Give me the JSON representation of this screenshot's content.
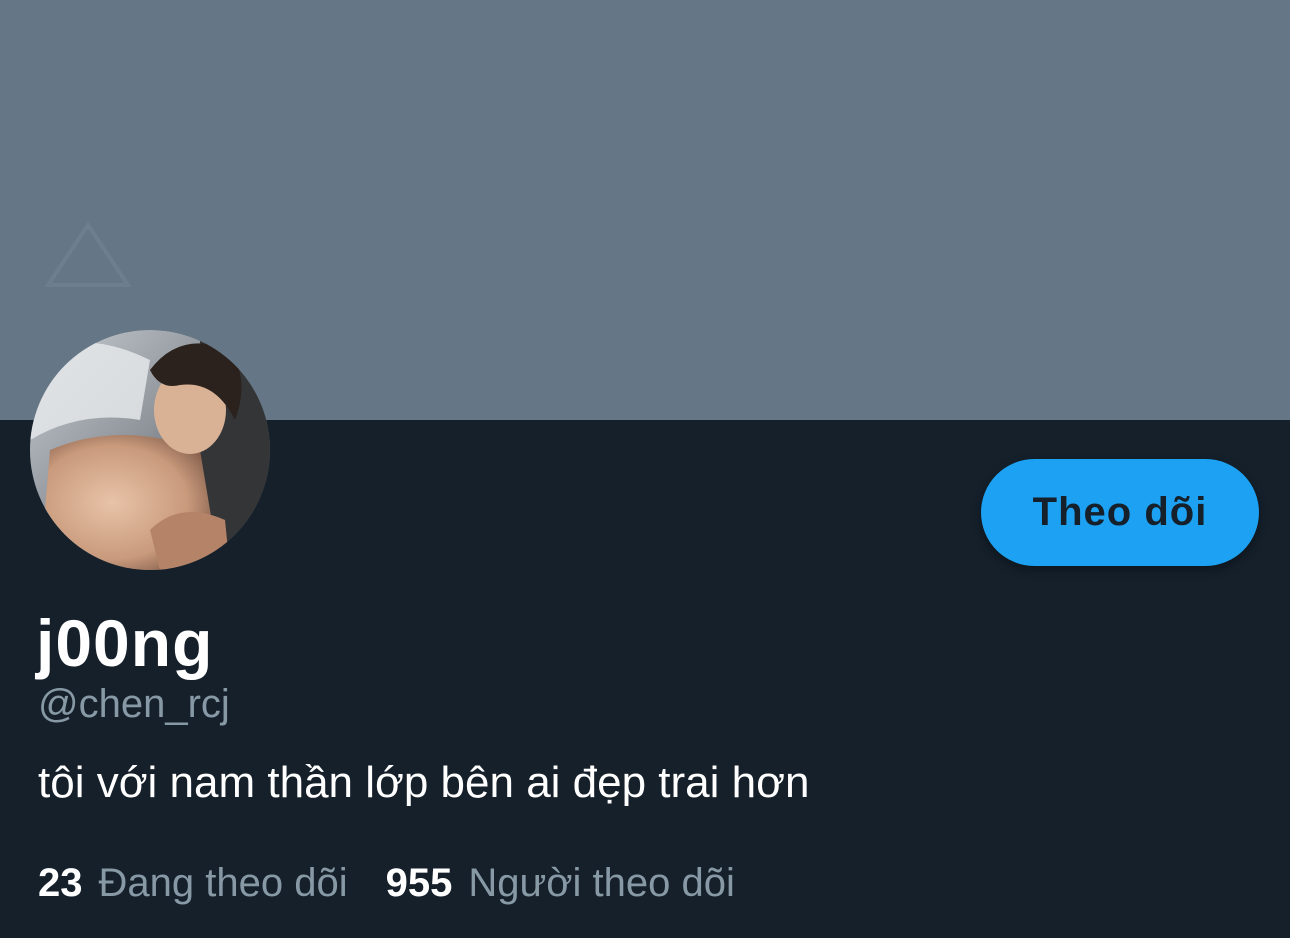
{
  "profile": {
    "display_name": "j00ng",
    "handle": "@chen_rcj",
    "bio": "tôi với nam thần lớp bên ai đẹp trai hơn",
    "follow_button_label": "Theo dõi"
  },
  "stats": {
    "following_count": "23",
    "following_label": "Đang theo dõi",
    "followers_count": "955",
    "followers_label": "Người theo dõi"
  },
  "colors": {
    "banner": "#657786",
    "background": "#15202b",
    "accent": "#1da1f2",
    "muted_text": "#8899a6",
    "primary_text": "#ffffff"
  }
}
